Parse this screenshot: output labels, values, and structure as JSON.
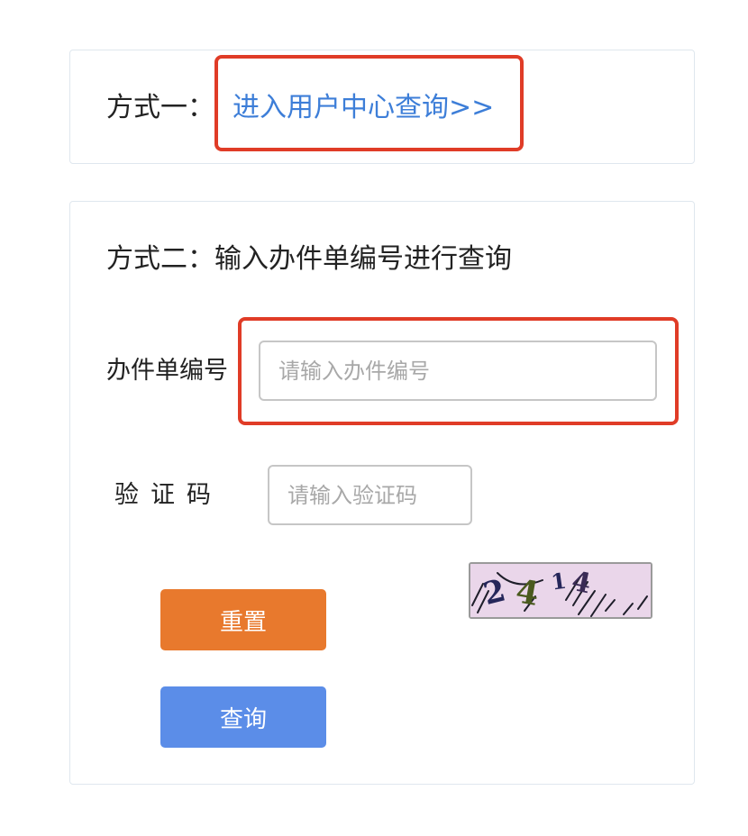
{
  "method1": {
    "label": "方式一：",
    "link_text": "进入用户中心查询>>"
  },
  "method2": {
    "title": "方式二：输入办件单编号进行查询",
    "order_field": {
      "label": "办件单编号",
      "placeholder": "请输入办件编号",
      "value": ""
    },
    "captcha_field": {
      "label": "验证码",
      "placeholder": "请输入验证码",
      "value": ""
    },
    "captcha_image": {
      "text": "2414",
      "background": "#ead6ea"
    },
    "reset_label": "重置",
    "query_label": "查询"
  },
  "colors": {
    "link": "#3d7ed8",
    "highlight": "#e03c27",
    "reset_button": "#e8792d",
    "query_button": "#5b8de8",
    "card_border": "#dfe7ee"
  }
}
